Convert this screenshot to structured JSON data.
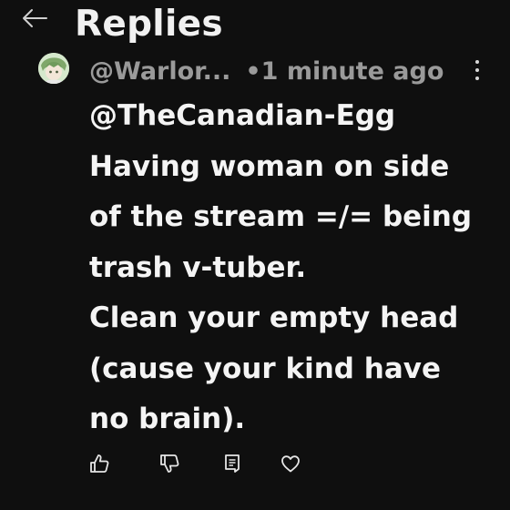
{
  "header": {
    "title": "Replies",
    "back_icon": "arrow-left-icon"
  },
  "comment": {
    "handle": "@Warlor...",
    "timestamp": "•1 minute ago",
    "more_icon": "more-vertical-icon",
    "lines": [
      "@TheCanadian-Egg",
      "Having woman on side",
      "of the stream =/= being",
      "trash v-tuber.",
      "Clean your empty head",
      "(cause your kind have",
      "no brain)."
    ]
  },
  "actions": {
    "like_icon": "thumbs-up-icon",
    "dislike_icon": "thumbs-down-icon",
    "reply_icon": "reply-comment-icon",
    "heart_icon": "heart-icon"
  },
  "colors": {
    "background": "#0f0f0f",
    "text": "#f4f4f4",
    "muted": "#9a9a9a"
  }
}
